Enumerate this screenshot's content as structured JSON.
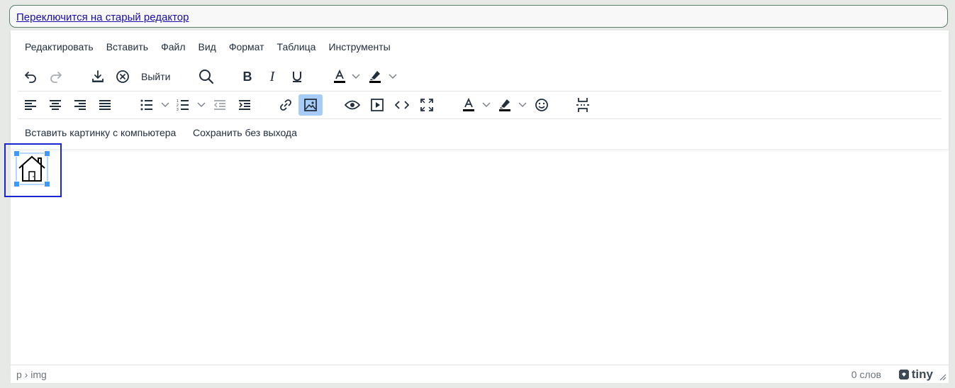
{
  "switch_link": "Переключится на старый редактор",
  "menubar": [
    "Редактировать",
    "Вставить",
    "Файл",
    "Вид",
    "Формат",
    "Таблица",
    "Инструменты"
  ],
  "toolbar": {
    "exit_label": "Выйти",
    "bold_glyph": "B",
    "italic_glyph": "I",
    "insert_image_label": "Вставить картинку с компьютера",
    "save_label": "Сохранить без выхода"
  },
  "content": {
    "image_icon": "house-icon"
  },
  "statusbar": {
    "path": "p › img",
    "word_count": "0 слов",
    "brand": "tiny"
  },
  "colors": {
    "active_button": "#a6ccf7",
    "selection_outline": "#1a23d6",
    "resize_handle": "#4099ff",
    "link": "#1a0dab"
  }
}
